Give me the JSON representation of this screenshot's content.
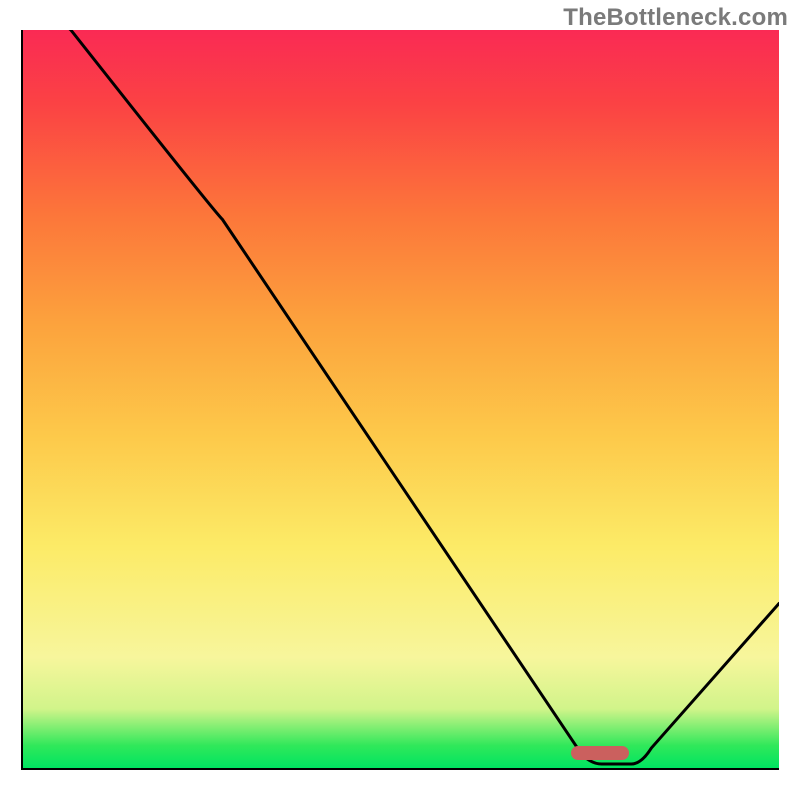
{
  "watermark": "TheBottleneck.com",
  "chart_data": {
    "type": "line",
    "title": "",
    "xlabel": "",
    "ylabel": "",
    "xlim": [
      0,
      100
    ],
    "ylim": [
      0,
      100
    ],
    "grid": false,
    "x": [
      0,
      6,
      26,
      74,
      80,
      100
    ],
    "values": [
      106,
      100,
      75,
      0,
      0,
      22
    ],
    "marker": {
      "x_start": 72,
      "x_end": 80,
      "y": 1.5
    },
    "gradient_stops": [
      {
        "pos": 0,
        "color": "#00e461"
      },
      {
        "pos": 3,
        "color": "#2fe85a"
      },
      {
        "pos": 8,
        "color": "#d1f48a"
      },
      {
        "pos": 15,
        "color": "#f7f69c"
      },
      {
        "pos": 30,
        "color": "#fceb67"
      },
      {
        "pos": 45,
        "color": "#fdc94a"
      },
      {
        "pos": 60,
        "color": "#fca33d"
      },
      {
        "pos": 75,
        "color": "#fc763a"
      },
      {
        "pos": 90,
        "color": "#fb4244"
      },
      {
        "pos": 100,
        "color": "#fa2a54"
      }
    ]
  }
}
